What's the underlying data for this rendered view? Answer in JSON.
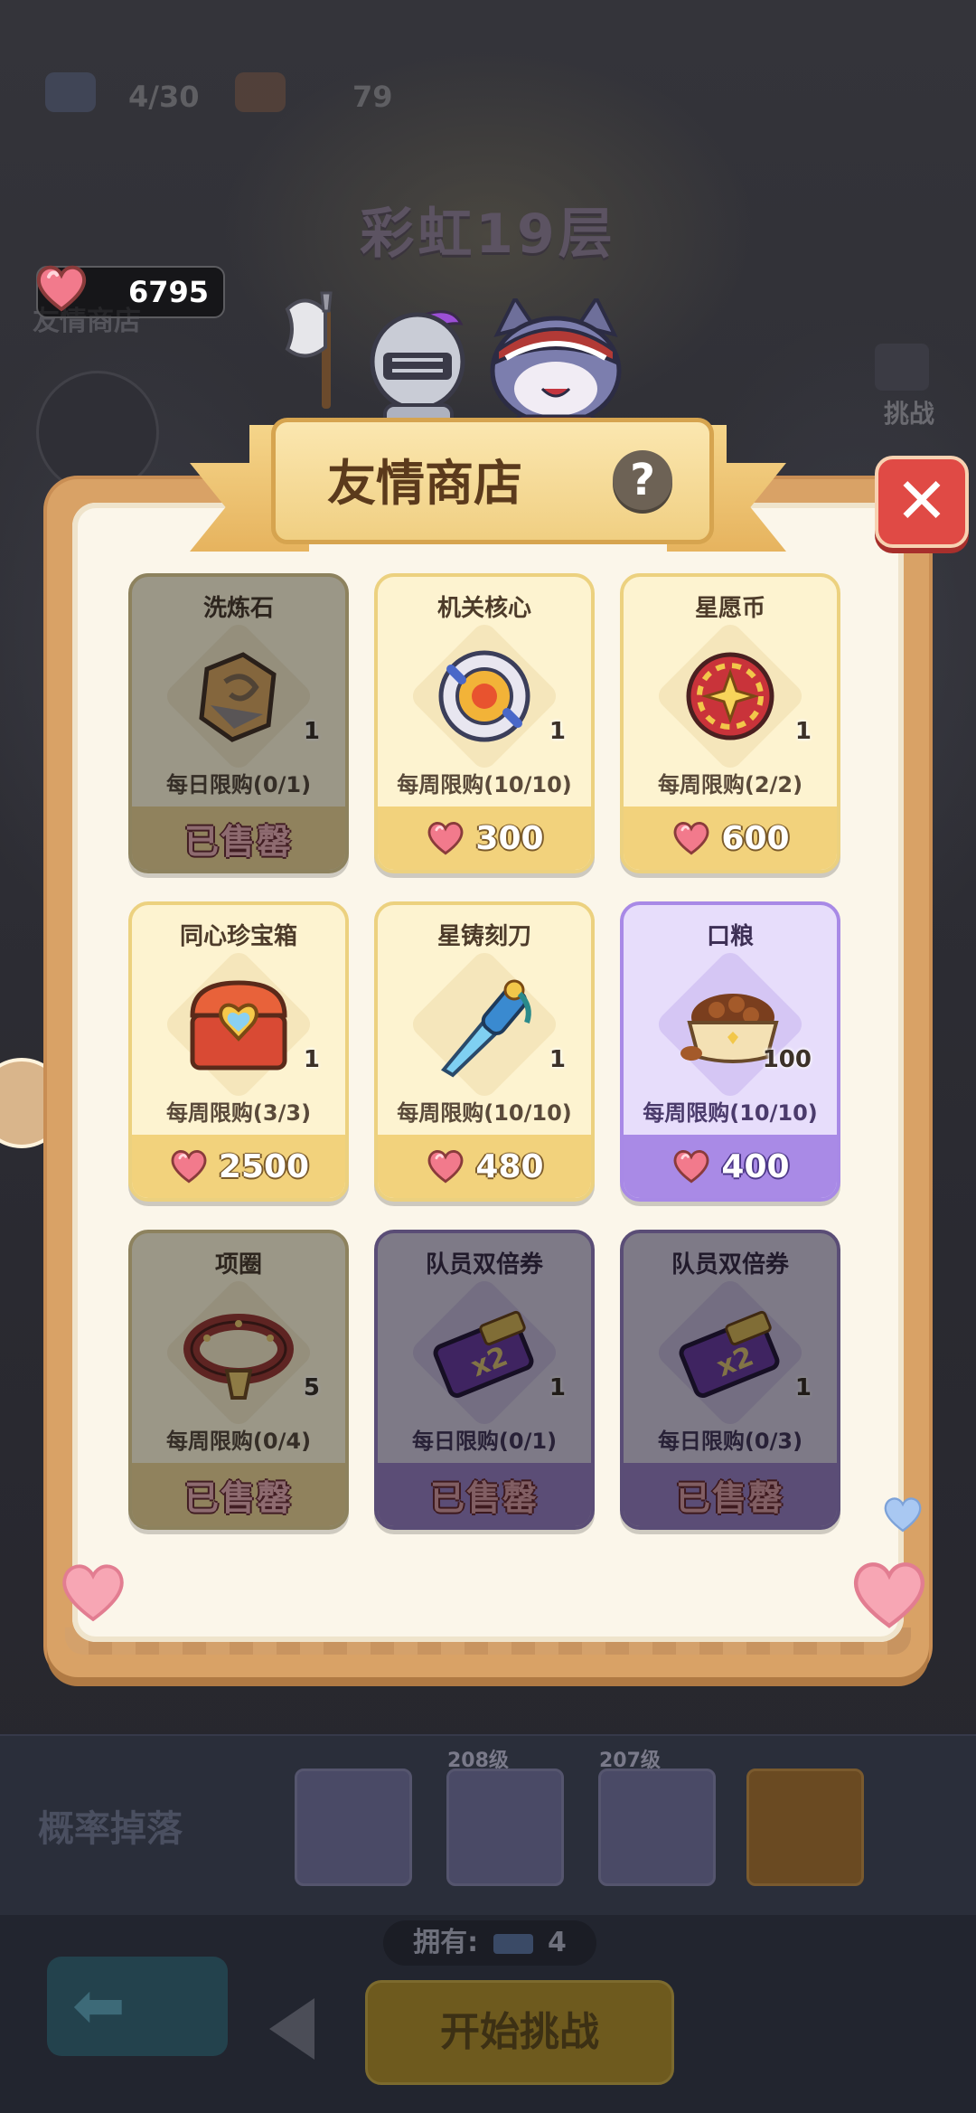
{
  "top_bar": {
    "ticket_count": "4/30",
    "meat_count": "79"
  },
  "floor_title": "彩虹19层",
  "friendship_points": "6795",
  "bg_friend_shop_label": "友情商店",
  "bg_challenge_label": "挑战",
  "shop": {
    "title": "友情商店",
    "help_label": "?",
    "close_label": "✕",
    "items": [
      {
        "name": "洗炼石",
        "qty": "1",
        "limit": "每日限购(0/1)",
        "price": "",
        "sold_label": "已售罄",
        "style": "yellow",
        "sold_out": true,
        "icon": "refine-stone-icon"
      },
      {
        "name": "机关核心",
        "qty": "1",
        "limit": "每周限购(10/10)",
        "price": "300",
        "sold_label": "",
        "style": "yellow",
        "sold_out": false,
        "icon": "mechanism-core-icon"
      },
      {
        "name": "星愿币",
        "qty": "1",
        "limit": "每周限购(2/2)",
        "price": "600",
        "sold_label": "",
        "style": "yellow",
        "sold_out": false,
        "icon": "wish-coin-icon"
      },
      {
        "name": "同心珍宝箱",
        "qty": "1",
        "limit": "每周限购(3/3)",
        "price": "2500",
        "sold_label": "",
        "style": "yellow",
        "sold_out": false,
        "icon": "treasure-chest-icon"
      },
      {
        "name": "星铸刻刀",
        "qty": "1",
        "limit": "每周限购(10/10)",
        "price": "480",
        "sold_label": "",
        "style": "yellow",
        "sold_out": false,
        "icon": "carving-knife-icon"
      },
      {
        "name": "口粮",
        "qty": "100",
        "limit": "每周限购(10/10)",
        "price": "400",
        "sold_label": "",
        "style": "purple",
        "sold_out": false,
        "icon": "food-bowl-icon"
      },
      {
        "name": "项圈",
        "qty": "5",
        "limit": "每周限购(0/4)",
        "price": "",
        "sold_label": "已售罄",
        "style": "yellow",
        "sold_out": true,
        "icon": "collar-icon"
      },
      {
        "name": "队员双倍券",
        "qty": "1",
        "limit": "每日限购(0/1)",
        "price": "",
        "sold_label": "已售罄",
        "style": "purple",
        "sold_out": true,
        "icon": "double-ticket-icon"
      },
      {
        "name": "队员双倍券",
        "qty": "1",
        "limit": "每日限购(0/3)",
        "price": "",
        "sold_label": "已售罄",
        "style": "purple",
        "sold_out": true,
        "icon": "double-ticket-icon"
      }
    ]
  },
  "bottom": {
    "drop_label": "概率掉落",
    "drop_levels": [
      "208级",
      "207级"
    ],
    "own_label": "拥有:",
    "own_count": "4",
    "start_label": "开始挑战"
  },
  "colors": {
    "heart": "#f06a7e",
    "card_yellow": "#fdf3d0",
    "card_purple": "#e7ddfb",
    "close_red": "#e04a45"
  }
}
